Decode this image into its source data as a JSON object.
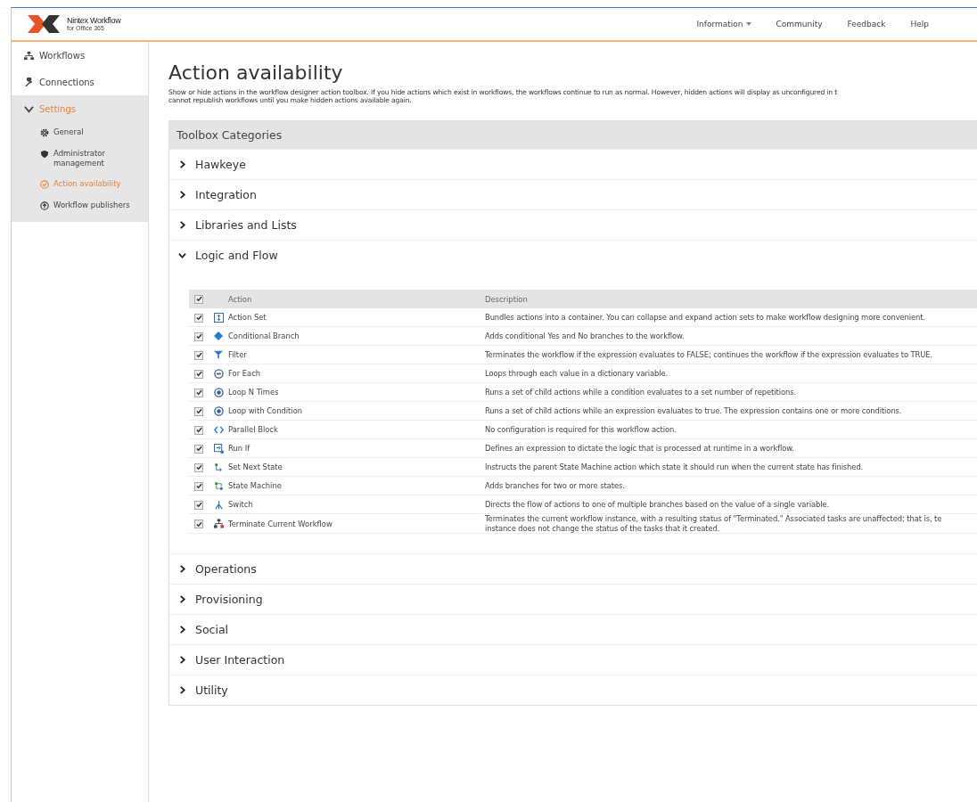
{
  "logo": {
    "name": "Nintex Workflow",
    "subtitle": "for Office 365"
  },
  "top_nav": [
    {
      "label": "Information",
      "dropdown": true
    },
    {
      "label": "Community",
      "dropdown": false
    },
    {
      "label": "Feedback",
      "dropdown": false
    },
    {
      "label": "Help",
      "dropdown": false
    }
  ],
  "sidebar": {
    "items": [
      {
        "label": "Workflows",
        "selected": false,
        "expanded": false
      },
      {
        "label": "Connections",
        "selected": false,
        "expanded": false
      },
      {
        "label": "Settings",
        "selected": true,
        "expanded": true,
        "children": [
          {
            "label": "General",
            "selected": false
          },
          {
            "label": "Administrator management",
            "selected": false
          },
          {
            "label": "Action availability",
            "selected": true
          },
          {
            "label": "Workflow publishers",
            "selected": false
          }
        ]
      }
    ]
  },
  "page": {
    "title": "Action availability",
    "intro": "Show or hide actions in the workflow designer action toolbox. If you hide actions which exist in workflows, the workflows continue to run as normal. However, hidden actions will display as unconfigured in t\ncannot republish workflows until you make hidden actions available again."
  },
  "toolbox": {
    "heading": "Toolbox Categories",
    "categories": [
      {
        "name": "Hawkeye",
        "expanded": false
      },
      {
        "name": "Integration",
        "expanded": false
      },
      {
        "name": "Libraries and Lists",
        "expanded": false
      },
      {
        "name": "Logic and Flow",
        "expanded": true,
        "table": {
          "all_checked": true,
          "columns": [
            "Action",
            "Description"
          ],
          "rows": [
            {
              "action": "Action Set",
              "description": "Bundles actions into a container. You can collapse and expand action sets to make workflow designing more convenient.",
              "checked": true
            },
            {
              "action": "Conditional Branch",
              "description": "Adds conditional Yes and No branches to the workflow.",
              "checked": true
            },
            {
              "action": "Filter",
              "description": "Terminates the workflow if the expression evaluates to FALSE; continues the workflow if the expression evaluates to TRUE.",
              "checked": true
            },
            {
              "action": "For Each",
              "description": "Loops through each value in a dictionary variable.",
              "checked": true
            },
            {
              "action": "Loop N Times",
              "description": "Runs a set of child actions while a condition evaluates to a set number of repetitions.",
              "checked": true
            },
            {
              "action": "Loop with Condition",
              "description": "Runs a set of child actions while an expression evaluates to true. The expression contains one or more conditions.",
              "checked": true
            },
            {
              "action": "Parallel Block",
              "description": "No configuration is required for this workflow action.",
              "checked": true
            },
            {
              "action": "Run If",
              "description": "Defines an expression to dictate the logic that is processed at runtime in a workflow.",
              "checked": true
            },
            {
              "action": "Set Next State",
              "description": "Instructs the parent State Machine action which state it should run when the current state has finished.",
              "checked": true
            },
            {
              "action": "State Machine",
              "description": "Adds branches for two or more states.",
              "checked": true
            },
            {
              "action": "Switch",
              "description": "Directs the flow of actions to one of multiple branches based on the value of a single variable.",
              "checked": true
            },
            {
              "action": "Terminate Current Workflow",
              "description": "Terminates the current workflow instance, with a resulting status of \"Terminated.\" Associated tasks are unaffected; that is, te\ninstance does not change the status of the tasks that it created.",
              "checked": true
            }
          ]
        }
      },
      {
        "name": "Operations",
        "expanded": false
      },
      {
        "name": "Provisioning",
        "expanded": false
      },
      {
        "name": "Social",
        "expanded": false
      },
      {
        "name": "User Interaction",
        "expanded": false
      },
      {
        "name": "Utility",
        "expanded": false
      }
    ]
  }
}
